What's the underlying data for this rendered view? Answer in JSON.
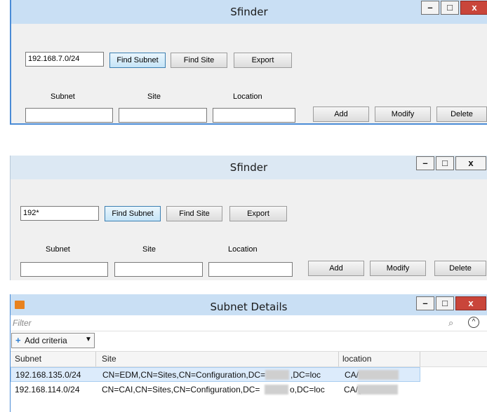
{
  "window1": {
    "title": "Sfinder",
    "controls": {
      "minimize": "–",
      "maximize": "□",
      "close": "x"
    },
    "search_value": "192.168.7.0/24",
    "buttons": {
      "find_subnet": "Find Subnet",
      "find_site": "Find Site",
      "export": "Export",
      "add": "Add",
      "modify": "Modify",
      "delete": "Delete"
    },
    "labels": {
      "subnet": "Subnet",
      "site": "Site",
      "location": "Location"
    }
  },
  "window2": {
    "title": "Sfinder",
    "controls": {
      "minimize": "–",
      "maximize": "□",
      "close": "x"
    },
    "search_value": "192*",
    "buttons": {
      "find_subnet": "Find Subnet",
      "find_site": "Find Site",
      "export": "Export",
      "add": "Add",
      "modify": "Modify",
      "delete": "Delete"
    },
    "labels": {
      "subnet": "Subnet",
      "site": "Site",
      "location": "Location"
    }
  },
  "window3": {
    "title": "Subnet Details",
    "controls": {
      "minimize": "–",
      "maximize": "□",
      "close": "x"
    },
    "filter_placeholder": "Filter",
    "add_criteria": "Add criteria",
    "columns": [
      "Subnet",
      "Site",
      "location"
    ],
    "rows": [
      {
        "subnet": "192.168.135.0/24",
        "site_a": "CN=EDM,CN=Sites,CN=Configuration,DC=",
        "site_b": ",DC=loc",
        "location": "CA/E"
      },
      {
        "subnet": "192.168.114.0/24",
        "site_a": "CN=CAI,CN=Sites,CN=Configuration,DC=",
        "site_b": "o,DC=loc",
        "location": "CA/("
      }
    ],
    "accent": "#e8821e"
  }
}
